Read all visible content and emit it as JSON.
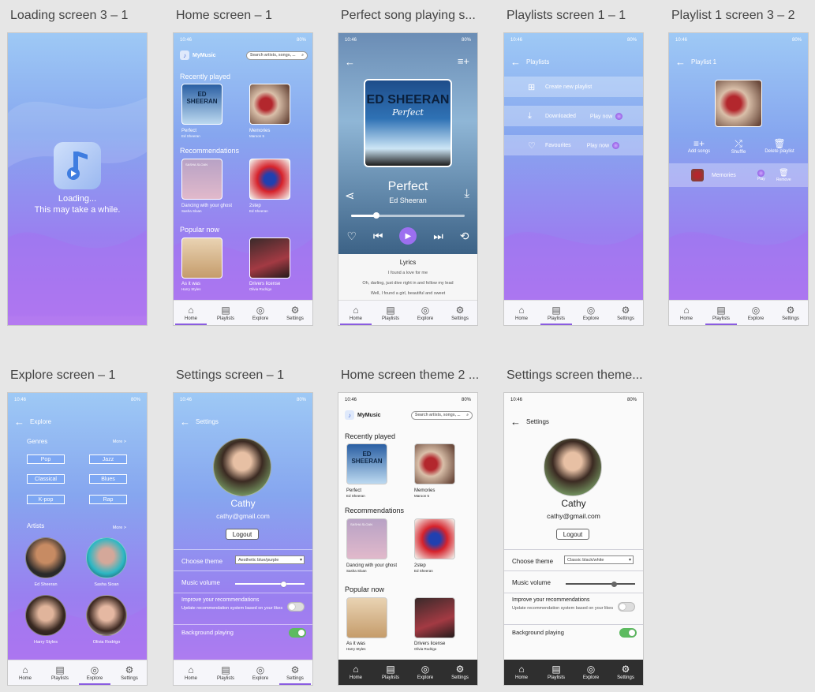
{
  "frames": {
    "loading": {
      "title": "Loading screen 3 – 1",
      "loading_text": "Loading...",
      "wait_text": "This may take a while."
    },
    "home": {
      "title": "Home screen – 1"
    },
    "playing": {
      "title": "Perfect song playing s..."
    },
    "playlists": {
      "title": "Playlists screen 1 – 1"
    },
    "playlist1": {
      "title": "Playlist 1 screen 3 – 2"
    },
    "explore": {
      "title": "Explore screen – 1"
    },
    "settings": {
      "title": "Settings screen – 1"
    },
    "home2": {
      "title": "Home screen theme 2 ..."
    },
    "settings2": {
      "title": "Settings screen theme..."
    }
  },
  "status": {
    "time": "10:46",
    "battery": "80%"
  },
  "app": {
    "name": "MyMusic",
    "search_placeholder": "Search artists, songs, ..."
  },
  "home": {
    "recent_label": "Recently played",
    "recommend_label": "Recommendations",
    "popular_label": "Popular now",
    "songs": [
      {
        "name": "Perfect",
        "artist": "Ed Sheeran"
      },
      {
        "name": "Memories",
        "artist": "Maroon 5"
      },
      {
        "name": "Dancing with your ghost",
        "artist": "Sasha Sloan"
      },
      {
        "name": "2step",
        "artist": "Ed Sheeran"
      },
      {
        "name": "As it was",
        "artist": "Harry Styles"
      },
      {
        "name": "Drivers license",
        "artist": "Olivia Rodrigo"
      }
    ],
    "cover_text": "ED SHEERAN",
    "cover_script": "Perfect",
    "sasha_cover": "SASHA SLOAN"
  },
  "nav": {
    "home": "Home",
    "playlists": "Playlists",
    "explore": "Explore",
    "settings": "Settings"
  },
  "player": {
    "song": "Perfect",
    "artist": "Ed Sheeran",
    "progress": 0.22,
    "lyrics_title": "Lyrics",
    "lyrics": [
      "I found a love for me",
      "Oh, darling, just dive right in and follow my lead",
      "Well, I found a girl, beautiful and sweet"
    ]
  },
  "playlists": {
    "header": "Playlists",
    "create": "Create new playlist",
    "downloaded": "Downloaded",
    "favourites": "Favourites",
    "play_now": "Play now"
  },
  "playlist1": {
    "header": "Playlist 1",
    "add_songs": "Add songs",
    "shuffle": "Shuffle",
    "delete": "Delete playlist",
    "song": "Memories",
    "play": "Play",
    "remove": "Remove"
  },
  "explore": {
    "header": "Explore",
    "genres_label": "Genres",
    "more": "More >",
    "genres": [
      "Pop",
      "Jazz",
      "Classical",
      "Blues",
      "K-pop",
      "Rap"
    ],
    "artists_label": "Artists",
    "artists": [
      "Ed Sheeran",
      "Sasha Sloan",
      "Harry Styles",
      "Olivia Rodrigo"
    ]
  },
  "settings": {
    "header": "Settings",
    "user": "Cathy",
    "email": "cathy@gmail.com",
    "logout": "Logout",
    "choose_theme": "Choose theme",
    "theme_value": "Aesthetic blue/purple",
    "theme_value_2": "Classic black/white",
    "volume_label": "Music volume",
    "volume_level": 0.7,
    "improve_label": "Improve your recommendations",
    "improve_sub": "Update recommendation system based on your likes",
    "improve_on": false,
    "background_label": "Background playing",
    "background_on": true
  },
  "colors": {
    "accent": "#8a5ce0",
    "toggle_on": "#5dbb60",
    "genre_btn": "#7da7f3"
  }
}
